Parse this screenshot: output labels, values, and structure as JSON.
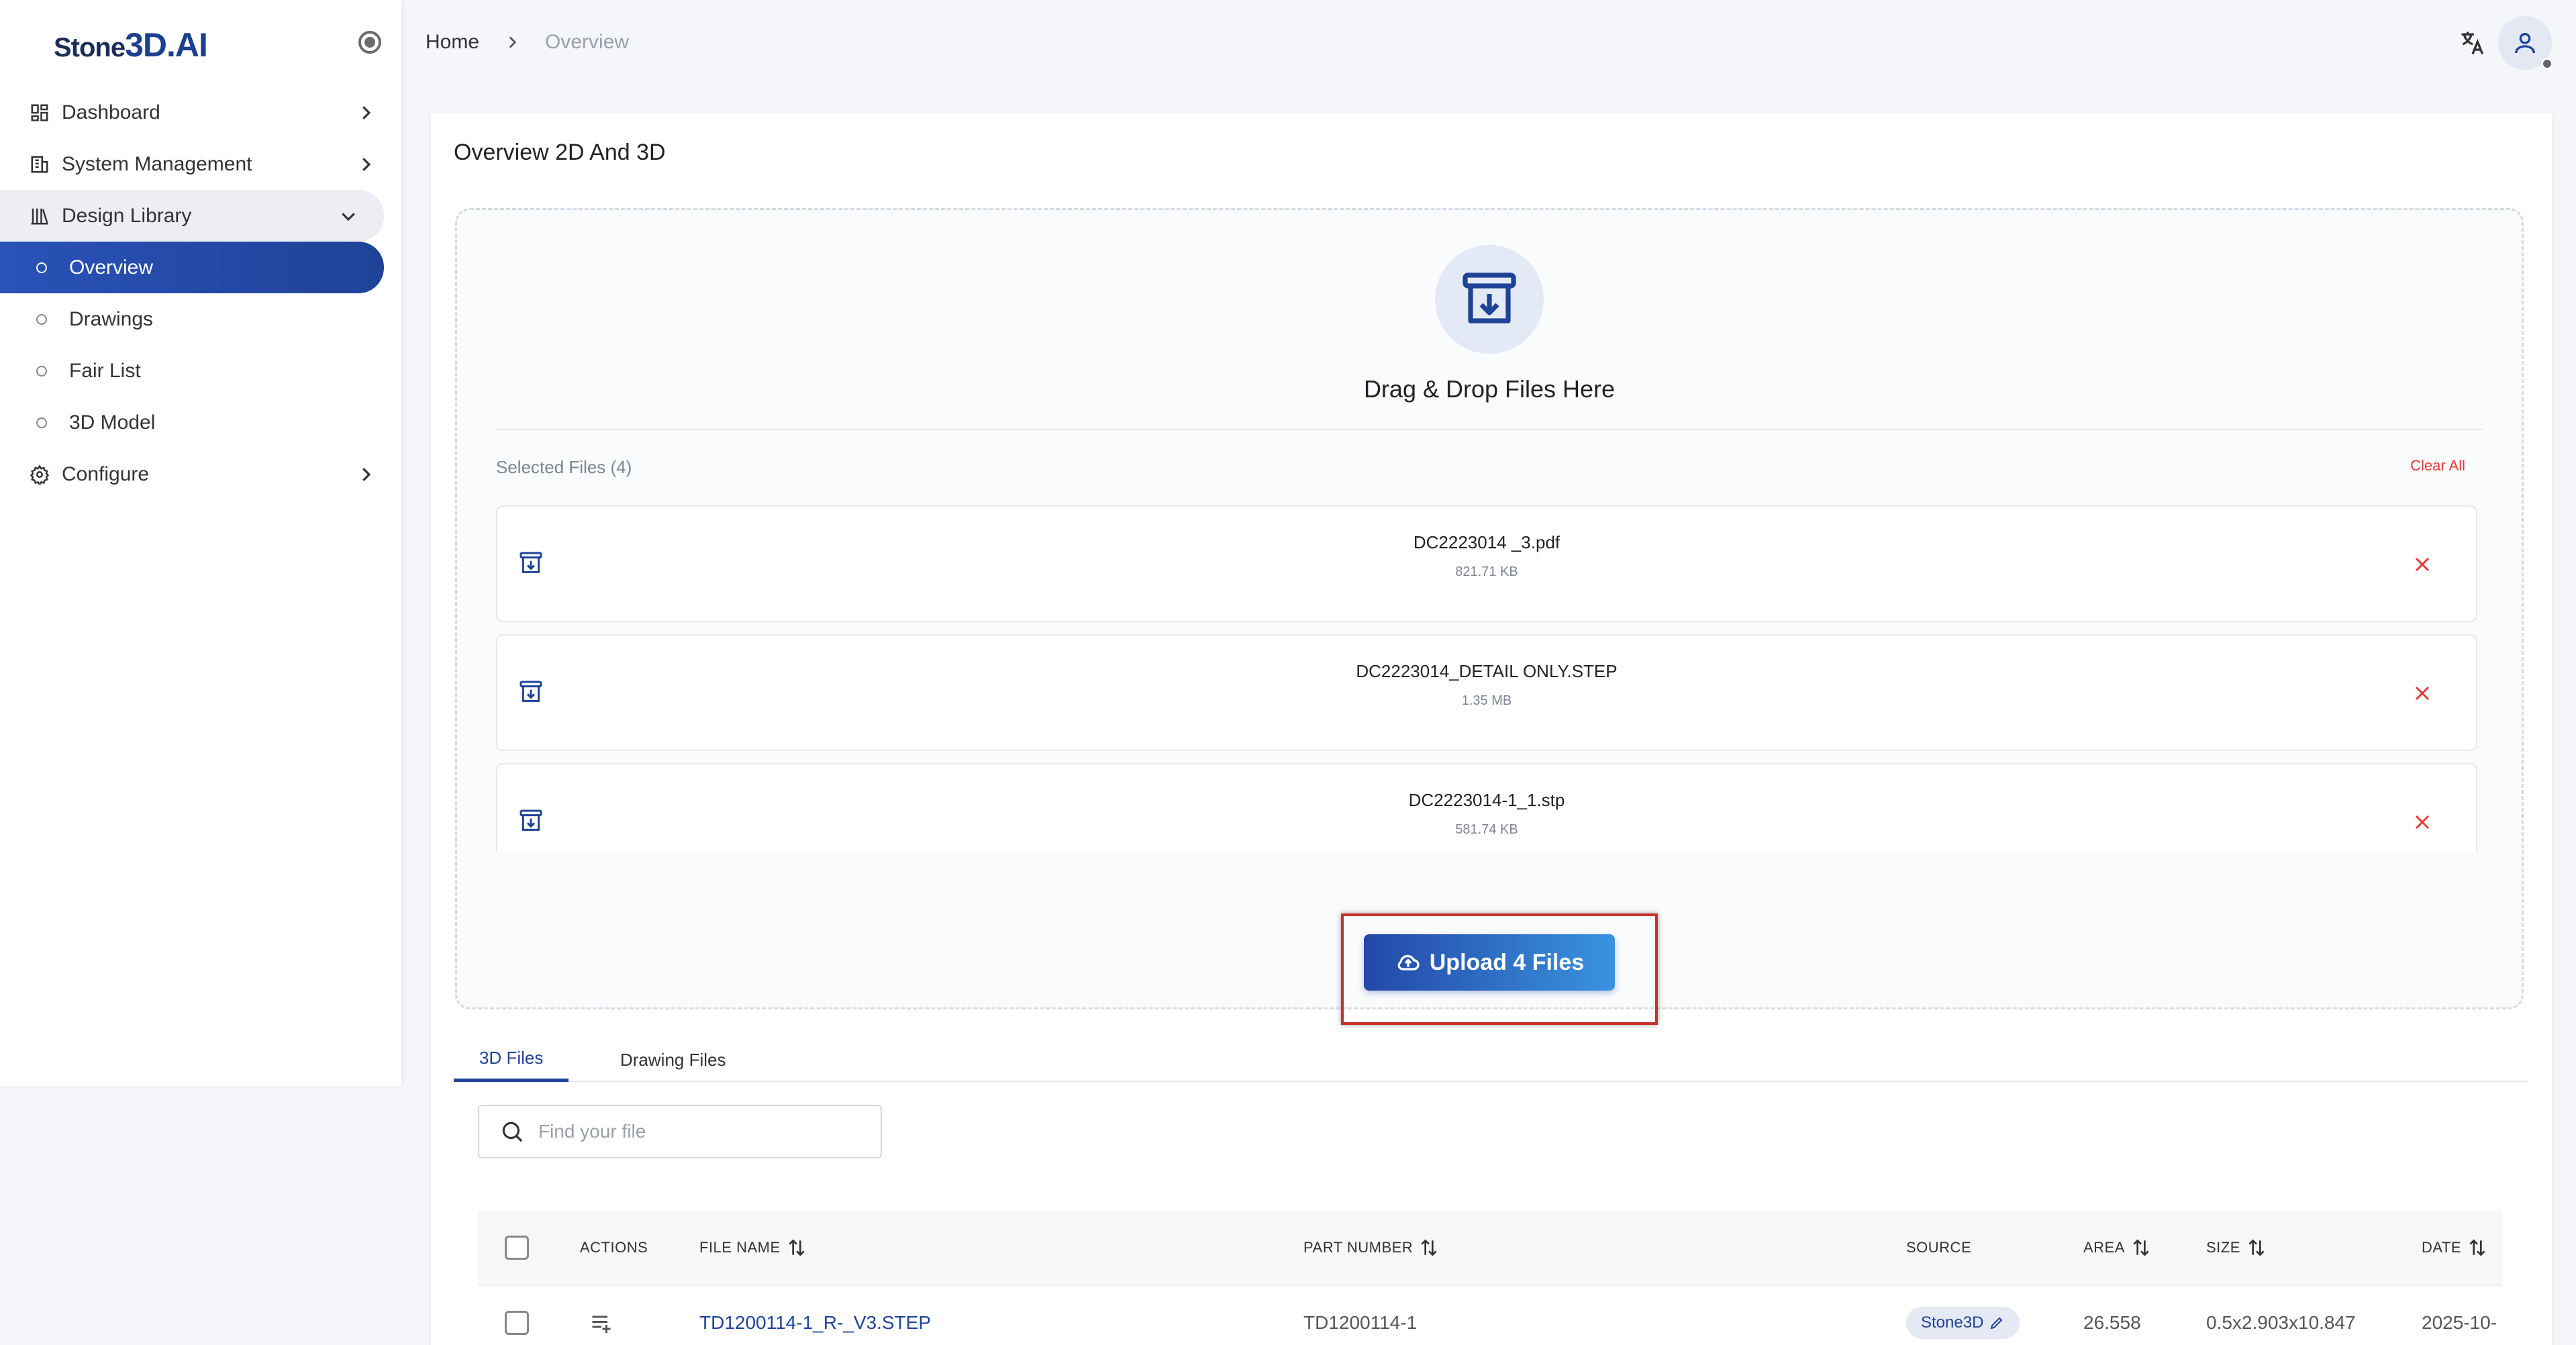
{
  "app": {
    "logo_prefix": "Stone",
    "logo_accent": "3D.AI"
  },
  "sidebar": {
    "items": [
      {
        "label": "Dashboard",
        "icon": "dashboard-icon"
      },
      {
        "label": "System Management",
        "icon": "building-icon"
      },
      {
        "label": "Design Library",
        "icon": "library-icon"
      },
      {
        "label": "Configure",
        "icon": "gear-icon"
      }
    ],
    "sub_items": [
      {
        "label": "Overview",
        "active": true
      },
      {
        "label": "Drawings"
      },
      {
        "label": "Fair List"
      },
      {
        "label": "3D Model"
      }
    ]
  },
  "breadcrumb": {
    "home": "Home",
    "current": "Overview"
  },
  "page": {
    "title": "Overview 2D And 3D"
  },
  "dropzone": {
    "text": "Drag & Drop Files Here",
    "selected_label": "Selected Files (4)",
    "clear_all": "Clear All",
    "files": [
      {
        "name": "DC2223014 _3.pdf",
        "size": "821.71 KB"
      },
      {
        "name": "DC2223014_DETAIL ONLY.STEP",
        "size": "1.35 MB"
      },
      {
        "name": "DC2223014-1_1.stp",
        "size": "581.74 KB"
      }
    ]
  },
  "upload": {
    "label": "Upload 4 Files"
  },
  "tabs": [
    {
      "label": "3D Files",
      "active": true
    },
    {
      "label": "Drawing Files"
    }
  ],
  "search": {
    "placeholder": "Find your file"
  },
  "table": {
    "headers": {
      "actions": "ACTIONS",
      "file_name": "FILE NAME",
      "part_number": "PART NUMBER",
      "source": "SOURCE",
      "area": "AREA",
      "size": "SIZE",
      "date": "DATE"
    },
    "rows": [
      {
        "file_name": "TD1200114-1_R-_V3.STEP",
        "part_number": "TD1200114-1",
        "source": "Stone3D",
        "area": "26.558",
        "size": "0.5x2.903x10.847",
        "date": "2025-10-"
      }
    ]
  },
  "colors": {
    "primary": "#1e4397",
    "danger": "#e53935",
    "highlight_border": "#c9302c"
  }
}
